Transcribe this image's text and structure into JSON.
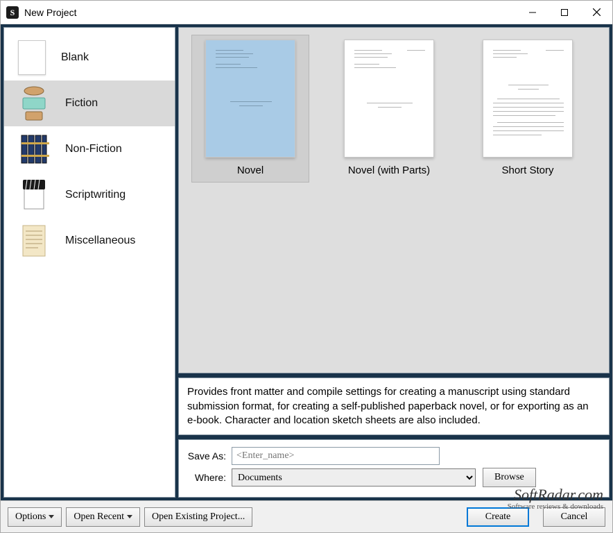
{
  "window": {
    "title": "New Project"
  },
  "categories": [
    {
      "id": "blank",
      "label": "Blank"
    },
    {
      "id": "fiction",
      "label": "Fiction",
      "selected": true
    },
    {
      "id": "nonfiction",
      "label": "Non-Fiction"
    },
    {
      "id": "script",
      "label": "Scriptwriting"
    },
    {
      "id": "misc",
      "label": "Miscellaneous"
    }
  ],
  "templates": [
    {
      "id": "novel",
      "label": "Novel",
      "selected": true
    },
    {
      "id": "novelparts",
      "label": "Novel (with Parts)"
    },
    {
      "id": "shortstory",
      "label": "Short Story"
    }
  ],
  "description": "Provides front matter and compile settings for creating a manuscript using standard submission format, for creating a self-published paperback novel, or for exporting as an e-book. Character and location sketch sheets are also included.",
  "form": {
    "saveas_label": "Save As:",
    "saveas_placeholder": "<Enter_name>",
    "saveas_value": "",
    "where_label": "Where:",
    "where_value": "Documents",
    "browse_label": "Browse"
  },
  "bottom": {
    "options": "Options",
    "open_recent": "Open Recent",
    "open_existing": "Open Existing Project...",
    "create": "Create",
    "cancel": "Cancel"
  },
  "watermark": {
    "brand": "SoftRadar.com",
    "tagline": "Software reviews & downloads"
  }
}
